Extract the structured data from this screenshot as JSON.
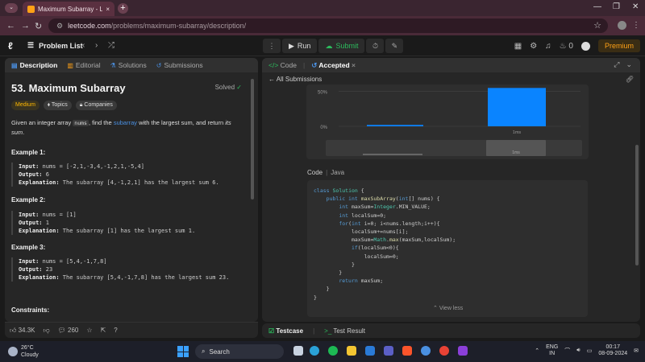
{
  "browser": {
    "tab_title": "Maximum Subarray - LeetCode",
    "url_domain": "leetcode.com",
    "url_path": "/problems/maximum-subarray/description/"
  },
  "nav": {
    "problem_list": "Problem List",
    "run": "Run",
    "submit": "Submit",
    "streak": "0",
    "premium": "Premium"
  },
  "left": {
    "tabs": [
      "Description",
      "Editorial",
      "Solutions",
      "Submissions"
    ],
    "title": "53. Maximum Subarray",
    "solved": "Solved",
    "tags": {
      "difficulty": "Medium",
      "topics": "Topics",
      "companies": "Companies"
    },
    "desc_pre": "Given an integer array ",
    "desc_code": "nums",
    "desc_mid": ", find the ",
    "desc_link": "subarray",
    "desc_post": " with the largest sum, and return ",
    "desc_em": "its sum",
    "desc_end": ".",
    "examples": [
      {
        "heading": "Example 1:",
        "input": "nums = [-2,1,-3,4,-1,2,1,-5,4]",
        "output": "6",
        "explanation": "The subarray [4,-1,2,1] has the largest sum 6."
      },
      {
        "heading": "Example 2:",
        "input": "nums = [1]",
        "output": "1",
        "explanation": "The subarray [1] has the largest sum 1."
      },
      {
        "heading": "Example 3:",
        "input": "nums = [5,4,-1,7,8]",
        "output": "23",
        "explanation": "The subarray [5,4,-1,7,8] has the largest sum 23."
      }
    ],
    "labels": {
      "input": "Input:",
      "output": "Output:",
      "explanation": "Explanation:"
    },
    "constraints": "Constraints:",
    "likes": "34.3K",
    "comments": "260"
  },
  "right": {
    "tabs": {
      "code": "Code",
      "accepted": "Accepted"
    },
    "all_submissions": "All Submissions",
    "code_label": "Code",
    "code_lang": "Java",
    "view_less": "View less",
    "bottom_tabs": {
      "testcase": "Testcase",
      "result": "Test Result"
    }
  },
  "chart_data": {
    "type": "bar",
    "categories": [
      "",
      "1ms"
    ],
    "values": [
      2,
      55
    ],
    "yticks": [
      "0%",
      "50%"
    ],
    "xlabel": "1ms",
    "ylim": [
      0,
      60
    ],
    "colors": {
      "bar": "#0a84ff",
      "grid": "#444444"
    }
  },
  "taskbar": {
    "temp": "26°C",
    "weather": "Cloudy",
    "search": "Search",
    "lang1": "ENG",
    "lang2": "IN",
    "time": "00:17",
    "date": "08-09-2024"
  }
}
